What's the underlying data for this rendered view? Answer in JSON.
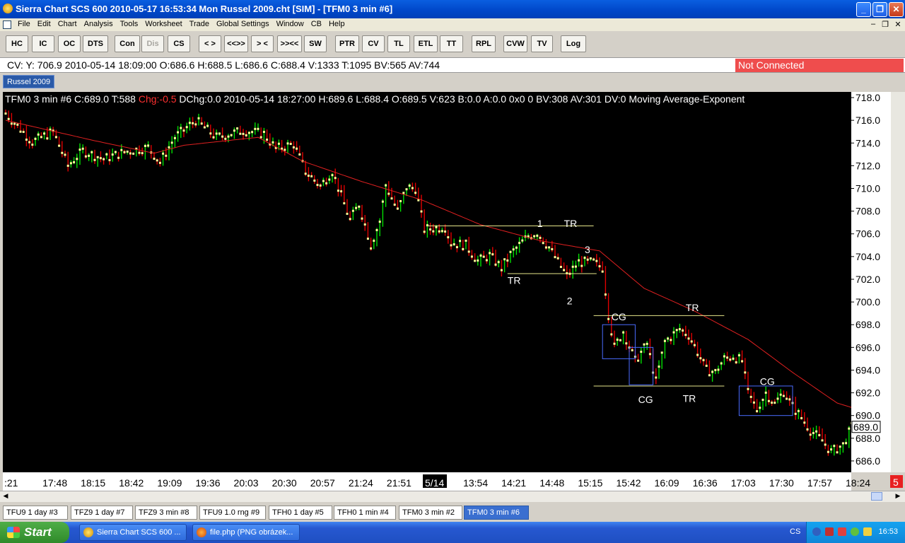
{
  "window": {
    "title": "Sierra Chart SCS 600   2010-05-17  16:53:34  Mon    Russel 2009.cht [SIM] - [TFM0  3 min   #6]",
    "btn_min": "_",
    "btn_max": "❐",
    "btn_close": "✕"
  },
  "menu": {
    "items": [
      "File",
      "Edit",
      "Chart",
      "Analysis",
      "Tools",
      "Worksheet",
      "Trade",
      "Global Settings",
      "Window",
      "CB",
      "Help"
    ],
    "mdi_min": "–",
    "mdi_restore": "❐",
    "mdi_close": "✕"
  },
  "toolbar": {
    "buttons": [
      "HC",
      "IC",
      "OC",
      "DTS",
      "Con",
      "Dis",
      "CS",
      "< >",
      "<<>>",
      "> <",
      ">><<",
      "SW",
      "PTR",
      "CV",
      "TL",
      "ETL",
      "TT",
      "RPL",
      "CVW",
      "TV",
      "Log"
    ]
  },
  "cv_bar": {
    "text": "CV: Y: 706.9  2010-05-14  18:09:00  O:686.6  H:688.5  L:686.6  C:688.4  V:1333  T:1095  BV:565  AV:744",
    "status": "Not Connected"
  },
  "chartbook_tab": "Russel 2009",
  "chart": {
    "header_a": "TFM0  3 min  #6 C:689.0 T:588 ",
    "header_chg": "Chg:-0.5",
    "header_b": " DChg:0.0 2010-05-14 18:27:00 H:689.6 L:688.4 O:689.5 V:623 B:0.0 A:0.0 0x0 0 BV:308 AV:301 DV:0 Moving Average-Exponent",
    "last_price": "689.0",
    "right_badge": "5",
    "colors": {
      "up_bar": "#00e000",
      "down_bar": "#e00000",
      "close_tick": "#ffff99",
      "moving_average": "#e02020",
      "annotation_line": "#e6e68a",
      "box": "#4a6cff",
      "header_change": "#ff3030"
    }
  },
  "chart_data": {
    "type": "ohlc-candlestick",
    "symbol": "TFM0",
    "interval": "3 min",
    "y_ticks": [
      "718.0",
      "716.0",
      "714.0",
      "712.0",
      "710.0",
      "708.0",
      "706.0",
      "704.0",
      "702.0",
      "700.0",
      "698.0",
      "696.0",
      "694.0",
      "692.0",
      "690.0",
      "688.0",
      "686.0"
    ],
    "ylim": [
      685.0,
      718.5
    ],
    "x_ticks": [
      ":21",
      "17:48",
      "18:15",
      "18:42",
      "19:09",
      "19:36",
      "20:03",
      "20:30",
      "20:57",
      "21:24",
      "21:51",
      "5/14",
      "13:54",
      "14:21",
      "14:48",
      "15:15",
      "15:42",
      "16:09",
      "16:36",
      "17:03",
      "17:30",
      "17:57",
      "18:24"
    ],
    "highlighted_x_tick": "5/14",
    "price_path": [
      [
        0,
        716.6
      ],
      [
        9,
        714.1
      ],
      [
        16,
        715.0
      ],
      [
        21,
        712.0
      ],
      [
        26,
        713.3
      ],
      [
        33,
        712.6
      ],
      [
        40,
        713.2
      ],
      [
        48,
        713.6
      ],
      [
        52,
        712.3
      ],
      [
        57,
        714.5
      ],
      [
        64,
        716.0
      ],
      [
        71,
        714.5
      ],
      [
        80,
        715.1
      ],
      [
        87,
        714.8
      ],
      [
        91,
        713.5
      ],
      [
        97,
        713.9
      ],
      [
        101,
        711.5
      ],
      [
        106,
        710.2
      ],
      [
        110,
        711.5
      ],
      [
        116,
        707.2
      ],
      [
        119,
        708.6
      ],
      [
        123,
        705.0
      ],
      [
        126,
        707.1
      ],
      [
        128,
        710.3
      ],
      [
        132,
        708.0
      ],
      [
        135,
        710.1
      ],
      [
        138,
        710.0
      ],
      [
        141,
        706.4
      ],
      [
        148,
        706.6
      ],
      [
        150,
        705.2
      ],
      [
        155,
        705.0
      ],
      [
        159,
        703.6
      ],
      [
        163,
        704.1
      ],
      [
        167,
        703.0
      ],
      [
        170,
        704.2
      ],
      [
        176,
        705.8
      ],
      [
        179,
        706.1
      ],
      [
        183,
        704.8
      ],
      [
        187,
        703.1
      ],
      [
        189,
        702.3
      ],
      [
        193,
        703.5
      ],
      [
        198,
        703.5
      ],
      [
        201,
        703.0
      ],
      [
        203,
        698.9
      ],
      [
        205,
        696.0
      ],
      [
        208,
        697.4
      ],
      [
        212,
        694.8
      ],
      [
        216,
        696.3
      ],
      [
        219,
        693.0
      ],
      [
        222,
        696.5
      ],
      [
        227,
        697.6
      ],
      [
        230,
        697.1
      ],
      [
        233,
        695.6
      ],
      [
        236,
        694.0
      ],
      [
        239,
        693.8
      ],
      [
        242,
        695.0
      ],
      [
        245,
        695.2
      ],
      [
        248,
        694.8
      ],
      [
        250,
        692.0
      ],
      [
        253,
        690.5
      ],
      [
        256,
        692.0
      ],
      [
        259,
        691.0
      ],
      [
        262,
        692.1
      ],
      [
        265,
        690.8
      ],
      [
        268,
        689.8
      ],
      [
        271,
        688.7
      ],
      [
        275,
        687.8
      ],
      [
        278,
        686.8
      ],
      [
        282,
        687.4
      ],
      [
        285,
        689.0
      ]
    ],
    "moving_average": [
      [
        0,
        716.0
      ],
      [
        30,
        714.2
      ],
      [
        50,
        713.1
      ],
      [
        60,
        713.8
      ],
      [
        85,
        714.5
      ],
      [
        100,
        712.4
      ],
      [
        120,
        710.6
      ],
      [
        140,
        709.0
      ],
      [
        160,
        706.8
      ],
      [
        180,
        705.4
      ],
      [
        200,
        704.5
      ],
      [
        215,
        701.2
      ],
      [
        232,
        699.2
      ],
      [
        250,
        696.7
      ],
      [
        265,
        693.8
      ],
      [
        280,
        691.1
      ],
      [
        285,
        690.7
      ]
    ],
    "annotations": {
      "labels": [
        {
          "text": "1",
          "x": 179,
          "y": 706.6
        },
        {
          "text": "TR",
          "x": 188,
          "y": 706.6
        },
        {
          "text": "TR",
          "x": 169,
          "y": 701.6
        },
        {
          "text": "3",
          "x": 195,
          "y": 704.3
        },
        {
          "text": "2",
          "x": 189,
          "y": 699.8
        },
        {
          "text": "CG",
          "x": 204,
          "y": 698.4
        },
        {
          "text": "TR",
          "x": 229,
          "y": 699.2
        },
        {
          "text": "CG",
          "x": 213,
          "y": 691.1
        },
        {
          "text": "TR",
          "x": 228,
          "y": 691.2
        },
        {
          "text": "CG",
          "x": 254,
          "y": 692.7
        }
      ],
      "lines": [
        {
          "x1": 142,
          "x2": 198,
          "y": 706.7
        },
        {
          "x1": 169,
          "x2": 199,
          "y": 702.5
        },
        {
          "x1": 198,
          "x2": 242,
          "y": 698.8
        },
        {
          "x1": 198,
          "x2": 242,
          "y": 692.6
        }
      ],
      "boxes": [
        {
          "x1": 201,
          "x2": 212,
          "y1": 698.0,
          "y2": 695.0
        },
        {
          "x1": 210,
          "x2": 218,
          "y1": 696.0,
          "y2": 692.7
        },
        {
          "x1": 247,
          "x2": 265,
          "y1": 692.6,
          "y2": 690.0
        }
      ]
    }
  },
  "bottom_tabs": [
    "TFU9  1 day  #3",
    "TFZ9  1 day  #7",
    "TFZ9  3 min  #8",
    "TFU9  1.0 rng  #9",
    "TFH0  1 day  #5",
    "TFH0  1 min  #4",
    "TFM0  3 min  #2",
    "TFM0  3 min  #6"
  ],
  "active_bottom_tab": "TFM0  3 min  #6",
  "taskbar": {
    "start": "Start",
    "tasks": [
      "Sierra Chart SCS 600 ...",
      "file.php (PNG obrázek..."
    ],
    "lang": "CS",
    "clock": "16:53"
  }
}
